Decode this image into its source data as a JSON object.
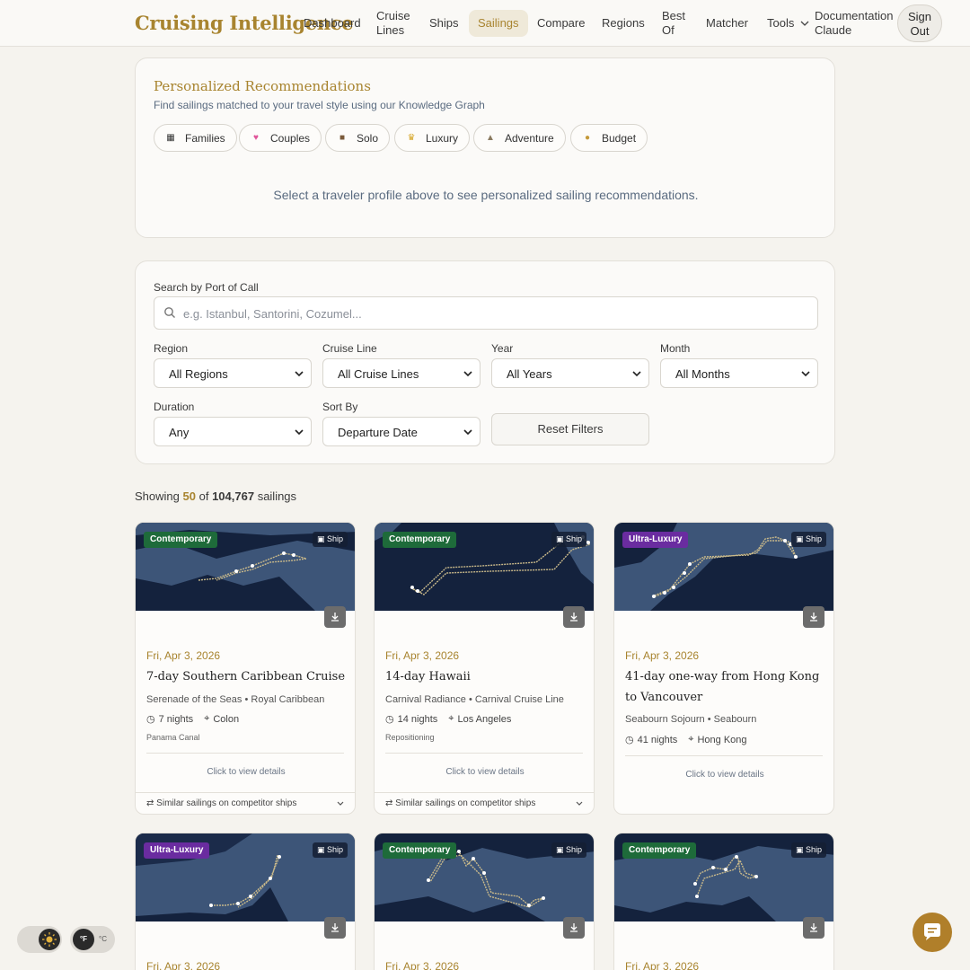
{
  "nav": {
    "brand": "Cruising Intelligence",
    "items": [
      {
        "label": "Dashboard"
      },
      {
        "label": "Cruise Lines"
      },
      {
        "label": "Ships"
      },
      {
        "label": "Sailings",
        "active": true
      },
      {
        "label": "Compare"
      },
      {
        "label": "Regions"
      },
      {
        "label": "Best Of"
      },
      {
        "label": "Matcher"
      },
      {
        "label": "Tools"
      },
      {
        "label": "Documentation Claude"
      }
    ],
    "signout": "Sign Out"
  },
  "recommendations": {
    "title": "Personalized Recommendations",
    "subtitle": "Find sailings matched to your travel style using our Knowledge Graph",
    "profiles": [
      {
        "label": "Families",
        "icon": "family-icon"
      },
      {
        "label": "Couples",
        "icon": "hearts-icon"
      },
      {
        "label": "Solo",
        "icon": "backpack-icon"
      },
      {
        "label": "Luxury",
        "icon": "crown-icon"
      },
      {
        "label": "Adventure",
        "icon": "mountain-icon"
      },
      {
        "label": "Budget",
        "icon": "money-bag-icon"
      }
    ],
    "empty_text": "Select a traveler profile above to see personalized sailing recommendations."
  },
  "filters": {
    "search_label": "Search by Port of Call",
    "search_placeholder": "e.g. Istanbul, Santorini, Cozumel...",
    "region_label": "Region",
    "region_value": "All Regions",
    "line_label": "Cruise Line",
    "line_value": "All Cruise Lines",
    "year_label": "Year",
    "year_value": "All Years",
    "month_label": "Month",
    "month_value": "All Months",
    "duration_label": "Duration",
    "duration_value": "Any",
    "sort_label": "Sort By",
    "sort_value": "Departure Date",
    "reset": "Reset Filters"
  },
  "results": {
    "prefix": "Showing",
    "shown": "50",
    "middle": "of",
    "total": "104,767",
    "suffix": "sailings"
  },
  "card_labels": {
    "ship": "Ship",
    "details": "Click to view details",
    "similar": "Similar sailings on competitor ships"
  },
  "sailings": [
    {
      "badge": "Contemporary",
      "date": "Fri, Apr 3, 2026",
      "title": "7-day Southern Caribbean Cruise",
      "ship": "Serenade of the Seas",
      "line": "Royal Caribbean",
      "nights": "7 nights",
      "port": "Colon",
      "tag": "Panama Canal"
    },
    {
      "badge": "Contemporary",
      "date": "Fri, Apr 3, 2026",
      "title": "14-day Hawaii",
      "ship": "Carnival Radiance",
      "line": "Carnival Cruise Line",
      "nights": "14 nights",
      "port": "Los Angeles",
      "tag": "Repositioning"
    },
    {
      "badge": "Ultra-Luxury",
      "date": "Fri, Apr 3, 2026",
      "title": "41-day one-way from Hong Kong to Vancouver",
      "ship": "Seabourn Sojourn",
      "line": "Seabourn",
      "nights": "41 nights",
      "port": "Hong Kong",
      "tag": ""
    },
    {
      "badge": "Ultra-Luxury",
      "date": "Fri, Apr 3, 2026"
    },
    {
      "badge": "Contemporary",
      "date": "Fri, Apr 3, 2026"
    },
    {
      "badge": "Contemporary",
      "date": "Fri, Apr 3, 2026"
    }
  ],
  "colors": {
    "accent": "#a8842f",
    "contemporary": "#1e6b3a",
    "ultra_luxury": "#6a2ca0",
    "map_sea": "#14223d",
    "map_land": "#3d5578"
  },
  "controls": {
    "unit_active": "°F",
    "unit_inactive": "°C"
  }
}
